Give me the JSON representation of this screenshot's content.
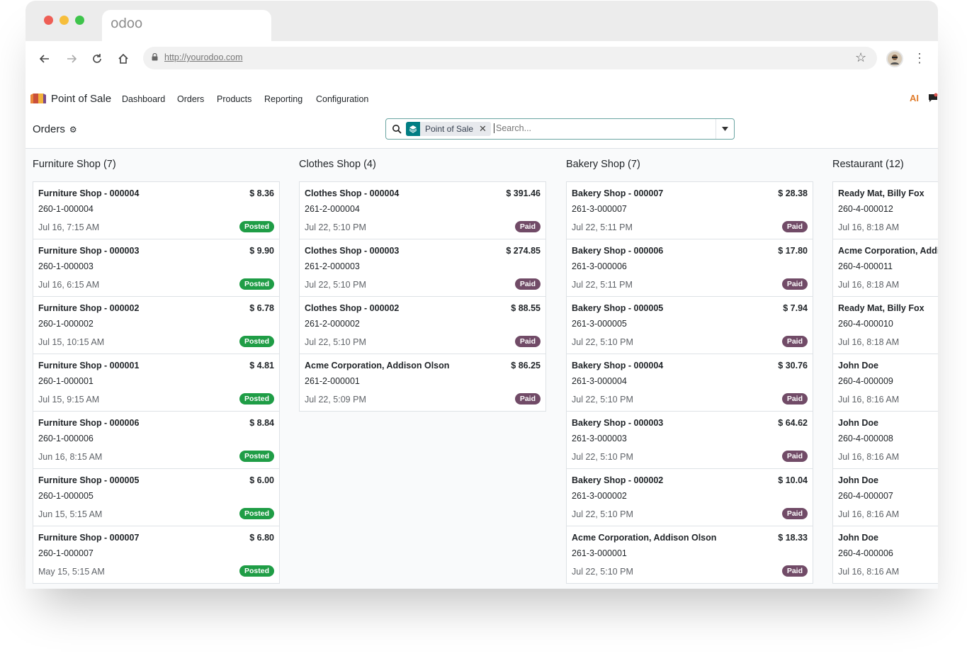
{
  "browser": {
    "tab_title": "odoo",
    "url": "http://yourodoo.com"
  },
  "navbar": {
    "app_name": "Point of Sale",
    "menu": [
      "Dashboard",
      "Orders",
      "Products",
      "Reporting",
      "Configuration"
    ],
    "ai_label": "AI"
  },
  "control_panel": {
    "breadcrumb": "Orders",
    "facet_label": "Point of Sale",
    "search_placeholder": "Search..."
  },
  "columns": [
    {
      "header": "Furniture Shop (7)",
      "cards": [
        {
          "name": "Furniture Shop - 000004",
          "amount": "$ 8.36",
          "ref": "260-1-000004",
          "date": "Jul 16, 7:15 AM",
          "status": "Posted"
        },
        {
          "name": "Furniture Shop - 000003",
          "amount": "$ 9.90",
          "ref": "260-1-000003",
          "date": "Jul 16, 6:15 AM",
          "status": "Posted"
        },
        {
          "name": "Furniture Shop - 000002",
          "amount": "$ 6.78",
          "ref": "260-1-000002",
          "date": "Jul 15, 10:15 AM",
          "status": "Posted"
        },
        {
          "name": "Furniture Shop - 000001",
          "amount": "$ 4.81",
          "ref": "260-1-000001",
          "date": "Jul 15, 9:15 AM",
          "status": "Posted"
        },
        {
          "name": "Furniture Shop - 000006",
          "amount": "$ 8.84",
          "ref": "260-1-000006",
          "date": "Jun 16, 8:15 AM",
          "status": "Posted"
        },
        {
          "name": "Furniture Shop - 000005",
          "amount": "$ 6.00",
          "ref": "260-1-000005",
          "date": "Jun 15, 5:15 AM",
          "status": "Posted"
        },
        {
          "name": "Furniture Shop - 000007",
          "amount": "$ 6.80",
          "ref": "260-1-000007",
          "date": "May 15, 5:15 AM",
          "status": "Posted"
        }
      ]
    },
    {
      "header": "Clothes Shop (4)",
      "cards": [
        {
          "name": "Clothes Shop - 000004",
          "amount": "$ 391.46",
          "ref": "261-2-000004",
          "date": "Jul 22, 5:10 PM",
          "status": "Paid"
        },
        {
          "name": "Clothes Shop - 000003",
          "amount": "$ 274.85",
          "ref": "261-2-000003",
          "date": "Jul 22, 5:10 PM",
          "status": "Paid"
        },
        {
          "name": "Clothes Shop - 000002",
          "amount": "$ 88.55",
          "ref": "261-2-000002",
          "date": "Jul 22, 5:10 PM",
          "status": "Paid"
        },
        {
          "name": "Acme Corporation, Addison Olson",
          "amount": "$ 86.25",
          "ref": "261-2-000001",
          "date": "Jul 22, 5:09 PM",
          "status": "Paid"
        }
      ]
    },
    {
      "header": "Bakery Shop (7)",
      "cards": [
        {
          "name": "Bakery Shop - 000007",
          "amount": "$ 28.38",
          "ref": "261-3-000007",
          "date": "Jul 22, 5:11 PM",
          "status": "Paid"
        },
        {
          "name": "Bakery Shop - 000006",
          "amount": "$ 17.80",
          "ref": "261-3-000006",
          "date": "Jul 22, 5:11 PM",
          "status": "Paid"
        },
        {
          "name": "Bakery Shop - 000005",
          "amount": "$ 7.94",
          "ref": "261-3-000005",
          "date": "Jul 22, 5:10 PM",
          "status": "Paid"
        },
        {
          "name": "Bakery Shop - 000004",
          "amount": "$ 30.76",
          "ref": "261-3-000004",
          "date": "Jul 22, 5:10 PM",
          "status": "Paid"
        },
        {
          "name": "Bakery Shop - 000003",
          "amount": "$ 64.62",
          "ref": "261-3-000003",
          "date": "Jul 22, 5:10 PM",
          "status": "Paid"
        },
        {
          "name": "Bakery Shop - 000002",
          "amount": "$ 10.04",
          "ref": "261-3-000002",
          "date": "Jul 22, 5:10 PM",
          "status": "Paid"
        },
        {
          "name": "Acme Corporation, Addison Olson",
          "amount": "$ 18.33",
          "ref": "261-3-000001",
          "date": "Jul 22, 5:10 PM",
          "status": "Paid"
        }
      ]
    },
    {
      "header": "Restaurant (12)",
      "cards": [
        {
          "name": "Ready Mat, Billy Fox",
          "amount": "",
          "ref": "260-4-000012",
          "date": "Jul 16, 8:18 AM",
          "status": ""
        },
        {
          "name": "Acme Corporation, Addi",
          "amount": "",
          "ref": "260-4-000011",
          "date": "Jul 16, 8:18 AM",
          "status": ""
        },
        {
          "name": "Ready Mat, Billy Fox",
          "amount": "",
          "ref": "260-4-000010",
          "date": "Jul 16, 8:18 AM",
          "status": ""
        },
        {
          "name": "John Doe",
          "amount": "",
          "ref": "260-4-000009",
          "date": "Jul 16, 8:16 AM",
          "status": ""
        },
        {
          "name": "John Doe",
          "amount": "",
          "ref": "260-4-000008",
          "date": "Jul 16, 8:16 AM",
          "status": ""
        },
        {
          "name": "John Doe",
          "amount": "",
          "ref": "260-4-000007",
          "date": "Jul 16, 8:16 AM",
          "status": ""
        },
        {
          "name": "John Doe",
          "amount": "",
          "ref": "260-4-000006",
          "date": "Jul 16, 8:16 AM",
          "status": ""
        }
      ]
    }
  ],
  "colors": {
    "posted_badge": "#1f9d46",
    "paid_badge": "#714b67",
    "facet_icon": "#017e84",
    "search_border": "#6aa5a2"
  }
}
